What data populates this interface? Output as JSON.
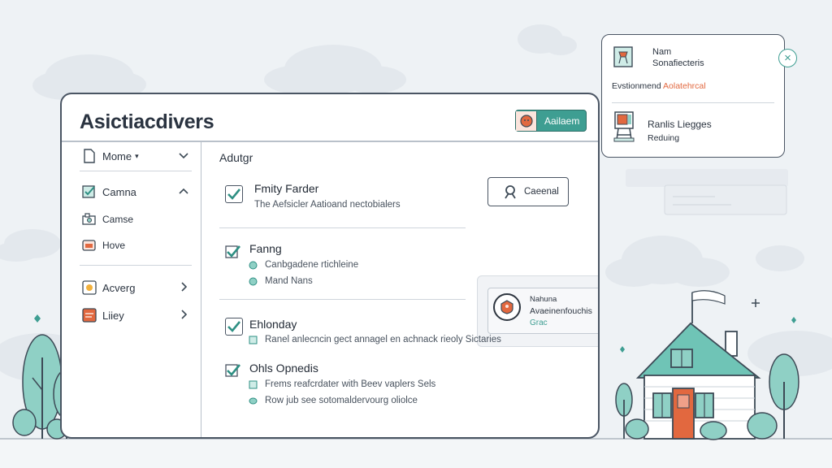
{
  "window": {
    "title": "Asictiacdivers",
    "header_button": {
      "label": "Aailaem",
      "icon": "avatar-icon"
    }
  },
  "sidebar": {
    "items": [
      {
        "label": "Mome",
        "icon": "file-icon",
        "suffix": "▾",
        "chevron": "down"
      },
      {
        "label": "Camna",
        "icon": "checkbox-icon",
        "chevron": "up"
      },
      {
        "label": "Camse",
        "icon": "camera-icon"
      },
      {
        "label": "Hove",
        "icon": "image-icon"
      },
      {
        "label": "Acverg",
        "icon": "tag-icon",
        "chevron": "right"
      },
      {
        "label": "Liiey",
        "icon": "note-icon",
        "chevron": "right"
      }
    ]
  },
  "content": {
    "section_title": "Adutgr",
    "items": [
      {
        "title": "Fmity Farder",
        "subs": [
          "The Aefsicler Aatioand nectobialers"
        ],
        "checked": true
      },
      {
        "title": "Fanng",
        "subs": [
          "Canbgadene rtichleine",
          "Mand Nans"
        ],
        "checked": true
      },
      {
        "title": "Ehlonday",
        "subs": [
          "Ranel anlecncin gect annagel en achnack rieoly Sictaries"
        ],
        "checked": true
      },
      {
        "title": "Ohls Opnedis",
        "subs": [
          "Frems reafcrdater with Beev vaplers Sels",
          "Row jub see sotomaldervourg oliolce"
        ],
        "checked": true
      }
    ],
    "outline_button": {
      "label": "Caeenal",
      "icon": "user-icon"
    },
    "panel": {
      "line1": "Nahuna",
      "line2": "Avaeinenfouchis",
      "line3": "Grac",
      "icon": "badge-icon"
    }
  },
  "popup": {
    "name_label": "Nam",
    "subtitle": "Sonafiecteris",
    "status_prefix": "Evstionmend",
    "status_accent": "Aolatehrcal",
    "item_title": "Ranlis Liegges",
    "item_sub": "Reduing",
    "close_icon": "close-icon"
  },
  "colors": {
    "accent": "#3e9e92",
    "orange": "#e2683f",
    "outline": "#4a5563"
  }
}
